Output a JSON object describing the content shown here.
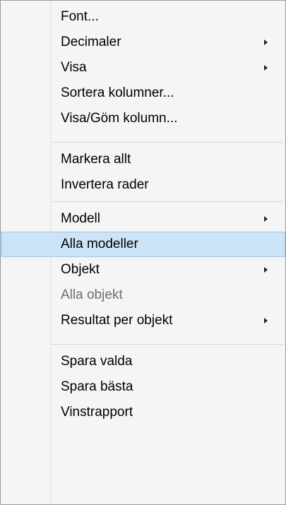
{
  "menu": {
    "group1": [
      {
        "label": "Font...",
        "submenu": false
      },
      {
        "label": "Decimaler",
        "submenu": true
      },
      {
        "label": "Visa",
        "submenu": true
      },
      {
        "label": "Sortera kolumner...",
        "submenu": false
      },
      {
        "label": "Visa/Göm kolumn...",
        "submenu": false
      }
    ],
    "group2": [
      {
        "label": "Markera allt",
        "submenu": false
      },
      {
        "label": "Invertera rader",
        "submenu": false
      }
    ],
    "group3": [
      {
        "label": "Modell",
        "submenu": true
      },
      {
        "label": "Alla modeller",
        "submenu": false,
        "highlighted": true
      },
      {
        "label": "Objekt",
        "submenu": true
      },
      {
        "label": "Alla objekt",
        "submenu": false,
        "disabled": true
      },
      {
        "label": "Resultat per objekt",
        "submenu": true
      }
    ],
    "group4": [
      {
        "label": "Spara valda",
        "submenu": false
      },
      {
        "label": "Spara bästa",
        "submenu": false
      },
      {
        "label": "Vinstrapport",
        "submenu": false
      }
    ]
  },
  "colors": {
    "menu_background": "#f5f5f5",
    "highlight_fill": "#cce4f7",
    "highlight_border": "#99c9ef",
    "disabled_text": "#6d6d6d"
  }
}
